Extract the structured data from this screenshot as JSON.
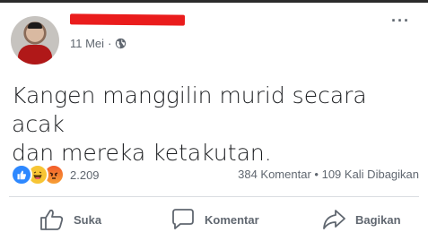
{
  "post": {
    "date": "11 Mei",
    "separator": "·",
    "more": "···",
    "text_line1": "Kangen manggilin murid secara acak",
    "text_line2": "dan mereka ketakutan."
  },
  "reactions": {
    "count": "2.209",
    "types": [
      "like-icon",
      "haha-icon",
      "angry-icon"
    ]
  },
  "stats": {
    "comments": "384 Komentar",
    "dot": "•",
    "shares": "109 Kali Dibagikan"
  },
  "actions": {
    "like_label": "Suka",
    "comment_label": "Komentar",
    "share_label": "Bagikan"
  },
  "colors": {
    "redaction": "#ea1c1c",
    "like": "#2d88ff",
    "haha": "#f7c534",
    "angry": "#f25c2a",
    "muted_text": "#606770"
  }
}
